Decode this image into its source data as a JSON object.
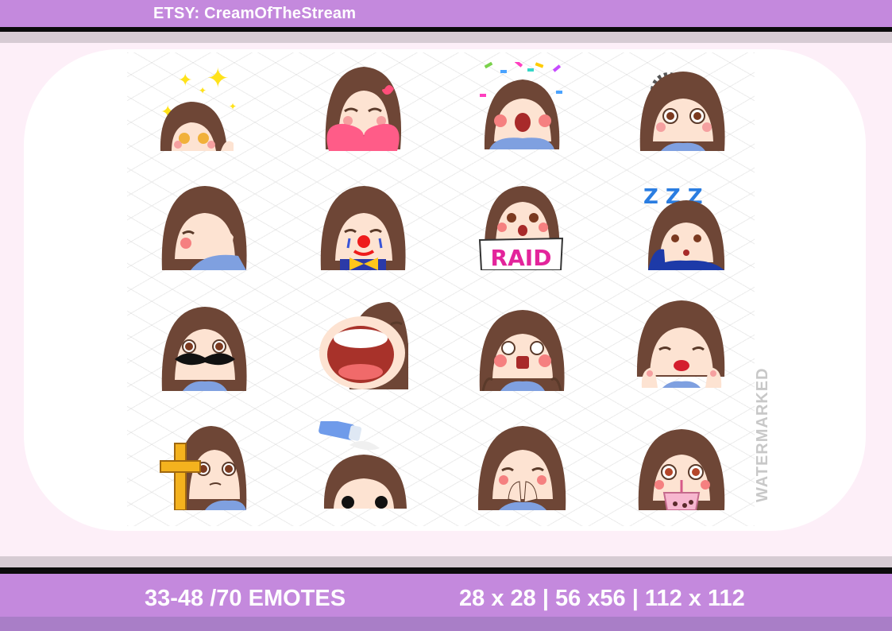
{
  "header": {
    "shop_label": "ETSY: CreamOfTheStream"
  },
  "footer": {
    "emote_count": "33-48 /70 EMOTES",
    "sizes": "28 x 28 | 56 x56 | 112 x 112"
  },
  "watermark": "WATERMARKED",
  "colors": {
    "accent": "#c489dd",
    "hair": "#6e4636",
    "skin": "#fde3d2",
    "shirt": "#7fa0e0",
    "blush": "#f5a0a0"
  },
  "emotes": [
    {
      "name": "sparkle-eyes"
    },
    {
      "name": "heart-love"
    },
    {
      "name": "confetti-hype"
    },
    {
      "name": "loading"
    },
    {
      "name": "facepalm"
    },
    {
      "name": "clown"
    },
    {
      "name": "raid-sign",
      "sign_text": "RAID"
    },
    {
      "name": "sleepy-zzz",
      "zzz": "Z Z Z"
    },
    {
      "name": "mustache"
    },
    {
      "name": "big-yell"
    },
    {
      "name": "shocked"
    },
    {
      "name": "kiss"
    },
    {
      "name": "holy-cross"
    },
    {
      "name": "salty"
    },
    {
      "name": "hands-face-laugh"
    },
    {
      "name": "boba-sip"
    }
  ]
}
